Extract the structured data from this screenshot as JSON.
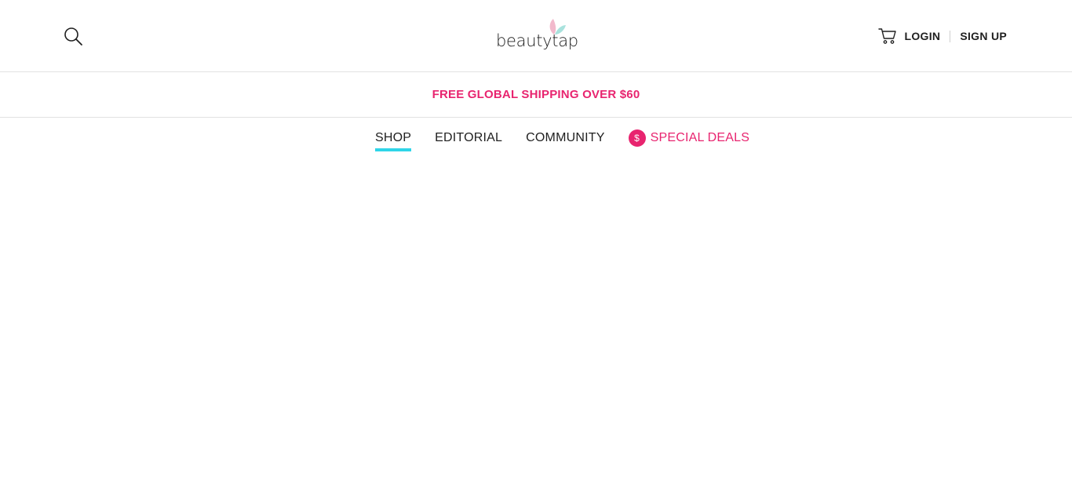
{
  "header": {
    "logo_text": "beautytap",
    "search_icon": "search-icon",
    "cart_icon": "cart-icon",
    "login_label": "LOGIN",
    "signup_label": "SIGN UP"
  },
  "promo": {
    "text": "FREE GLOBAL SHIPPING OVER $60"
  },
  "nav": {
    "items": [
      {
        "label": "SHOP",
        "active": true
      },
      {
        "label": "EDITORIAL",
        "active": false
      },
      {
        "label": "COMMUNITY",
        "active": false
      },
      {
        "label": "SPECIAL DEALS",
        "active": false,
        "badge": "$"
      }
    ]
  },
  "colors": {
    "accent_pink": "#e8246f",
    "active_underline": "#2fd5e8",
    "leaf_pink": "#f2b9cc",
    "leaf_teal": "#a9e2dd"
  }
}
